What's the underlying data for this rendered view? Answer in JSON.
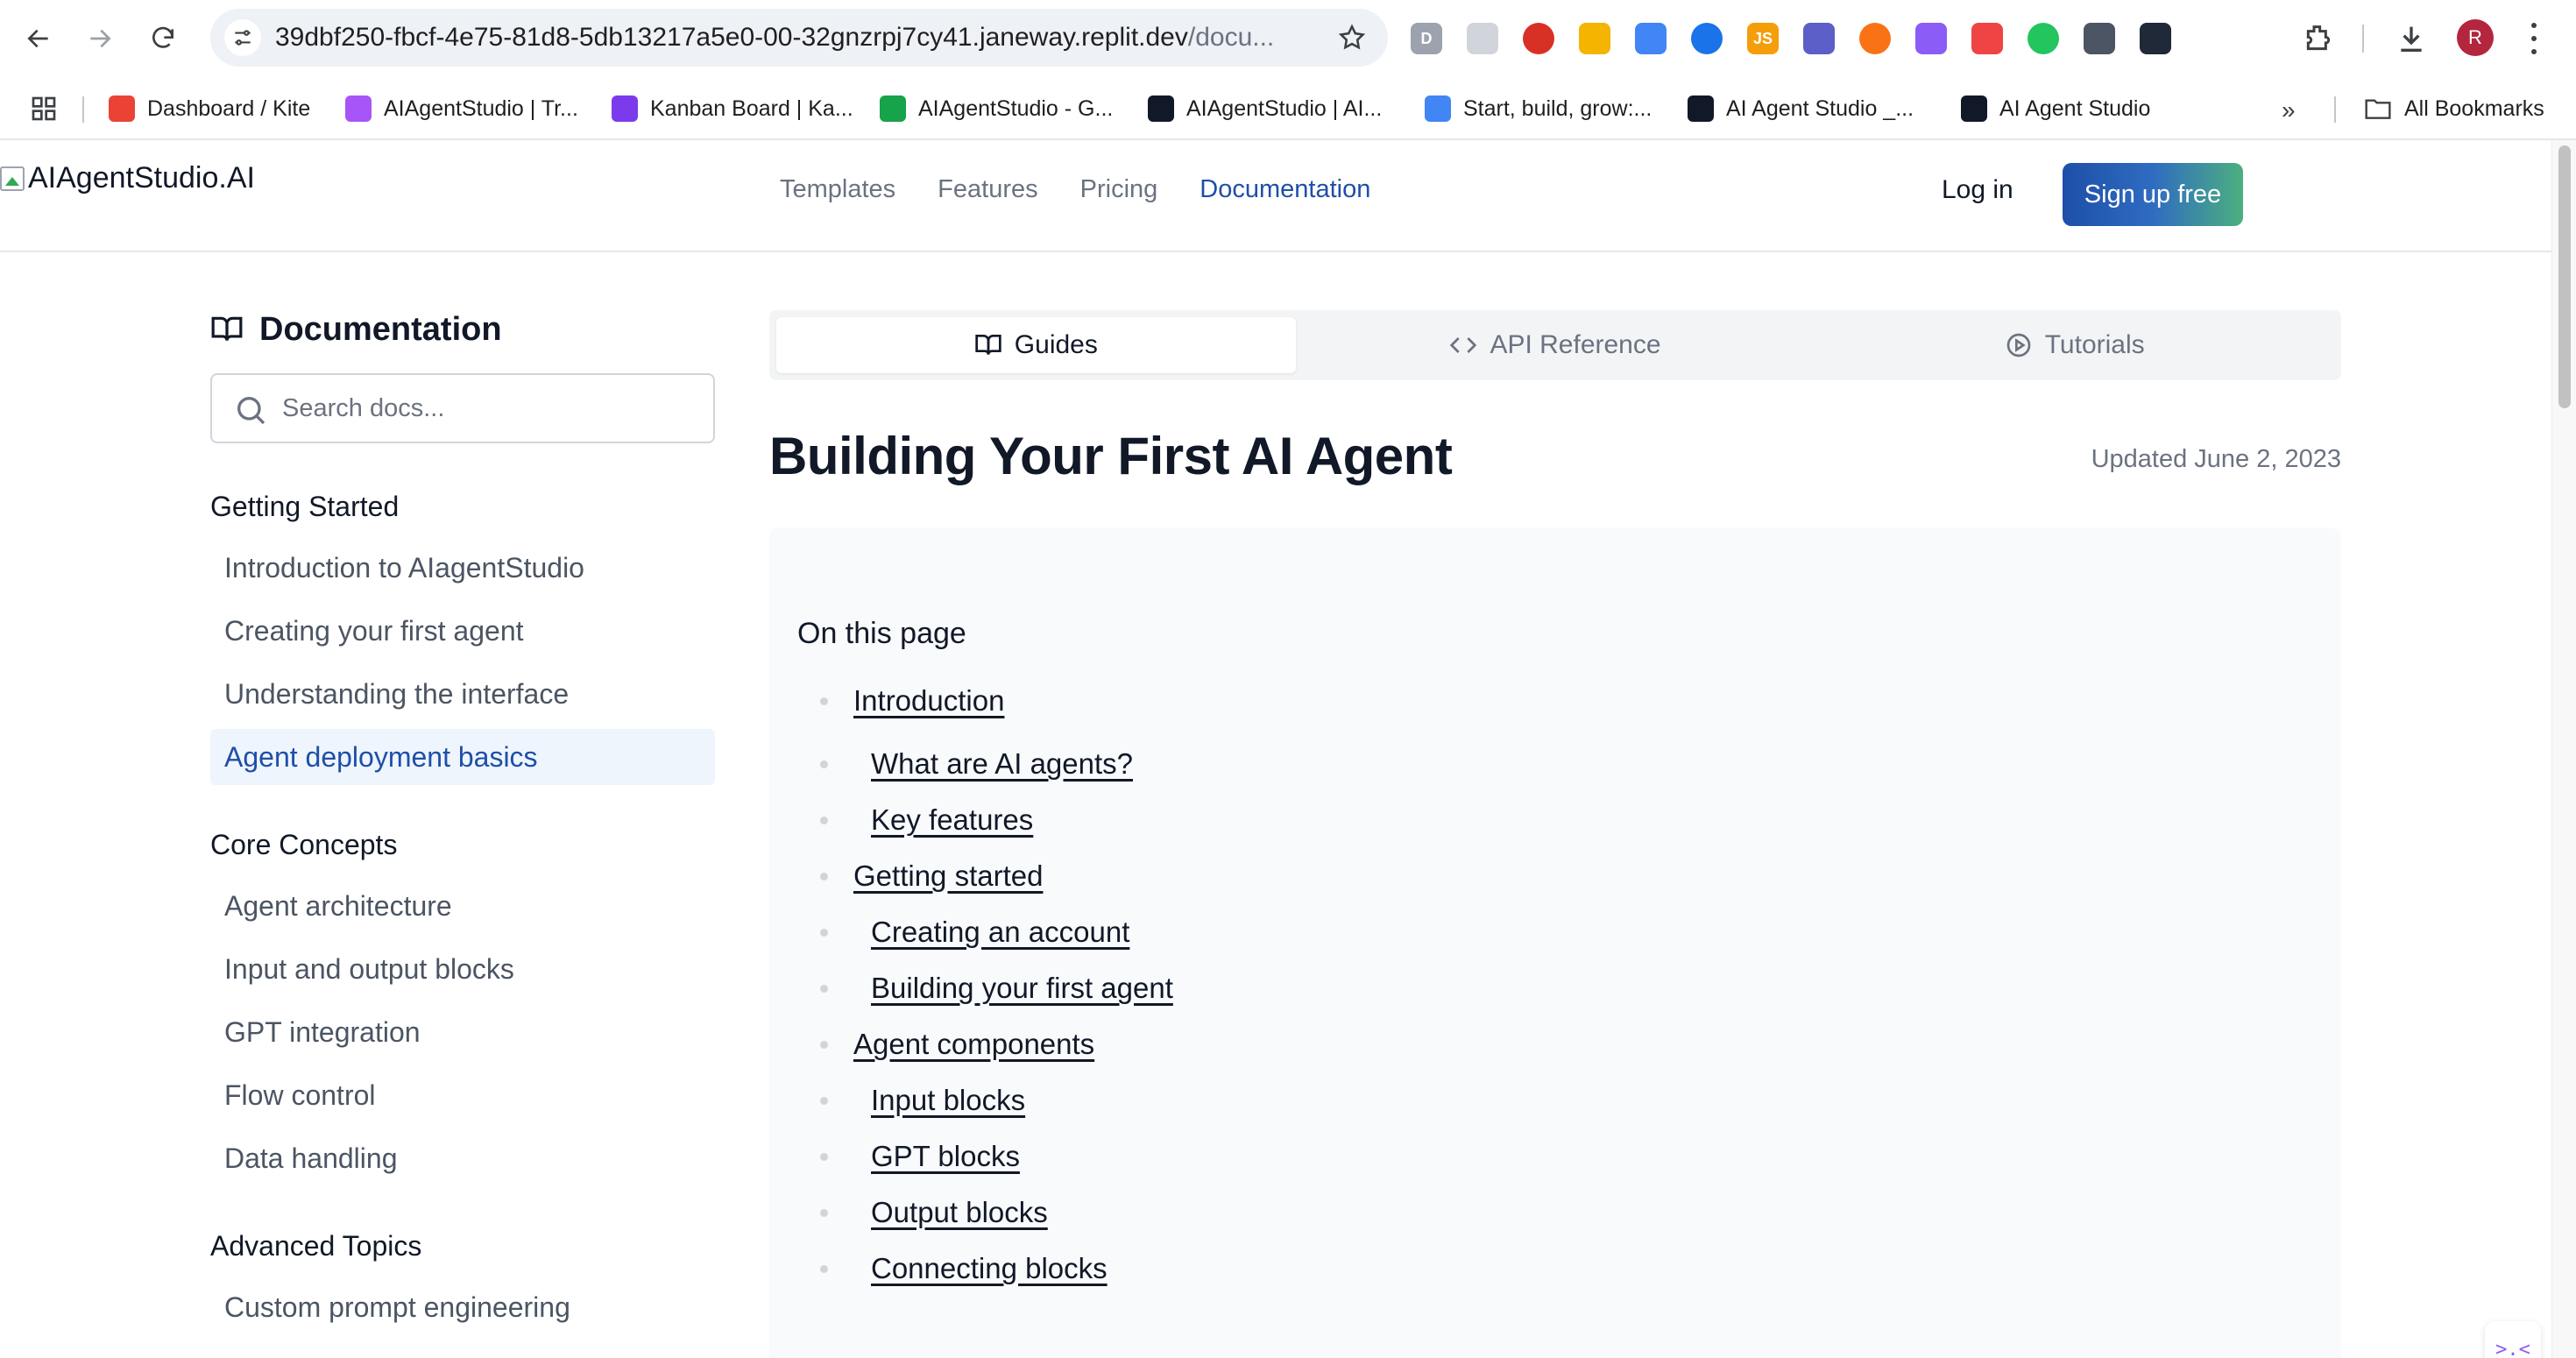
{
  "browser": {
    "url_main": "39dbf250-fbcf-4e75-81d8-5db13217a5e0-00-32gnzrpj7cy41.janeway.replit.dev",
    "url_path": "/docu...",
    "profile_initial": "R",
    "extensions": [
      {
        "icon": "d-extension-icon",
        "label": "D",
        "color": "#9ca3af"
      },
      {
        "icon": "safe-extension-icon",
        "label": "",
        "color": "#d1d5db"
      },
      {
        "icon": "play-extension-icon",
        "label": "",
        "color": "#d93025"
      },
      {
        "icon": "key-extension-icon",
        "label": "",
        "color": "#f4b400"
      },
      {
        "icon": "diamond-extension-icon",
        "label": "",
        "color": "#4285f4"
      },
      {
        "icon": "tag-extension-icon",
        "label": "",
        "color": "#1a73e8"
      },
      {
        "icon": "js-extension-icon",
        "label": "JS",
        "color": "#f59e0b"
      },
      {
        "icon": "grid-extension-icon",
        "label": "",
        "color": "#5b5fc7"
      },
      {
        "icon": "person-extension-icon",
        "label": "",
        "color": "#f97316"
      },
      {
        "icon": "face-extension-icon",
        "label": "",
        "color": "#8b5cf6"
      },
      {
        "icon": "fox-extension-icon",
        "label": "",
        "color": "#ef4444"
      },
      {
        "icon": "cart-extension-icon",
        "label": "",
        "color": "#22c55e"
      },
      {
        "icon": "info-extension-icon",
        "label": "",
        "color": "#4b5563"
      },
      {
        "icon": "camera-extension-icon",
        "label": "",
        "color": "#1f2937"
      }
    ],
    "bookmarks": [
      {
        "label": "Dashboard / Kite",
        "color": "#ea4335"
      },
      {
        "label": "AIAgentStudio | Tr...",
        "color": "#a855f7"
      },
      {
        "label": "Kanban Board | Ka...",
        "color": "#7c3aed"
      },
      {
        "label": "AIAgentStudio - G...",
        "color": "#16a34a"
      },
      {
        "label": "AIAgentStudio | AI...",
        "color": "#111827"
      },
      {
        "label": "Start, build, grow:...",
        "color": "#4285f4"
      },
      {
        "label": "AI Agent Studio _...",
        "color": "#111827"
      },
      {
        "label": "AI Agent Studio",
        "color": "#111827"
      }
    ],
    "all_bookmarks": "All Bookmarks"
  },
  "site": {
    "logo_alt": "AIAgentStudio.AI",
    "nav": [
      {
        "label": "Templates",
        "active": false
      },
      {
        "label": "Features",
        "active": false
      },
      {
        "label": "Pricing",
        "active": false
      },
      {
        "label": "Documentation",
        "active": true
      }
    ],
    "login": "Log in",
    "signup": "Sign up free"
  },
  "sidebar": {
    "title": "Documentation",
    "search_placeholder": "Search docs...",
    "sections": [
      {
        "title": "Getting Started",
        "items": [
          {
            "label": "Introduction to AIagentStudio",
            "active": false
          },
          {
            "label": "Creating your first agent",
            "active": false
          },
          {
            "label": "Understanding the interface",
            "active": false
          },
          {
            "label": "Agent deployment basics",
            "active": true
          }
        ]
      },
      {
        "title": "Core Concepts",
        "items": [
          {
            "label": "Agent architecture",
            "active": false
          },
          {
            "label": "Input and output blocks",
            "active": false
          },
          {
            "label": "GPT integration",
            "active": false
          },
          {
            "label": "Flow control",
            "active": false
          },
          {
            "label": "Data handling",
            "active": false
          }
        ]
      },
      {
        "title": "Advanced Topics",
        "items": [
          {
            "label": "Custom prompt engineering",
            "active": false
          }
        ]
      }
    ]
  },
  "content": {
    "tabs": [
      {
        "label": "Guides",
        "icon": "book-open-icon",
        "active": true
      },
      {
        "label": "API Reference",
        "icon": "code-icon",
        "active": false
      },
      {
        "label": "Tutorials",
        "icon": "play-circle-icon",
        "active": false
      }
    ],
    "title": "Building Your First AI Agent",
    "updated": "Updated June 2, 2023",
    "toc_heading": "On this page",
    "toc": [
      {
        "label": "Introduction",
        "level": 1
      },
      {
        "label": "What are AI agents?",
        "level": 2
      },
      {
        "label": "Key features",
        "level": 2
      },
      {
        "label": "Getting started",
        "level": 1
      },
      {
        "label": "Creating an account",
        "level": 2
      },
      {
        "label": "Building your first agent",
        "level": 2
      },
      {
        "label": "Agent components",
        "level": 1
      },
      {
        "label": "Input blocks",
        "level": 2
      },
      {
        "label": "GPT blocks",
        "level": 2
      },
      {
        "label": "Output blocks",
        "level": 2
      },
      {
        "label": "Connecting blocks",
        "level": 2
      }
    ]
  },
  "widget": {
    "icon": "chat-widget-icon",
    "glyph": ">.<"
  }
}
